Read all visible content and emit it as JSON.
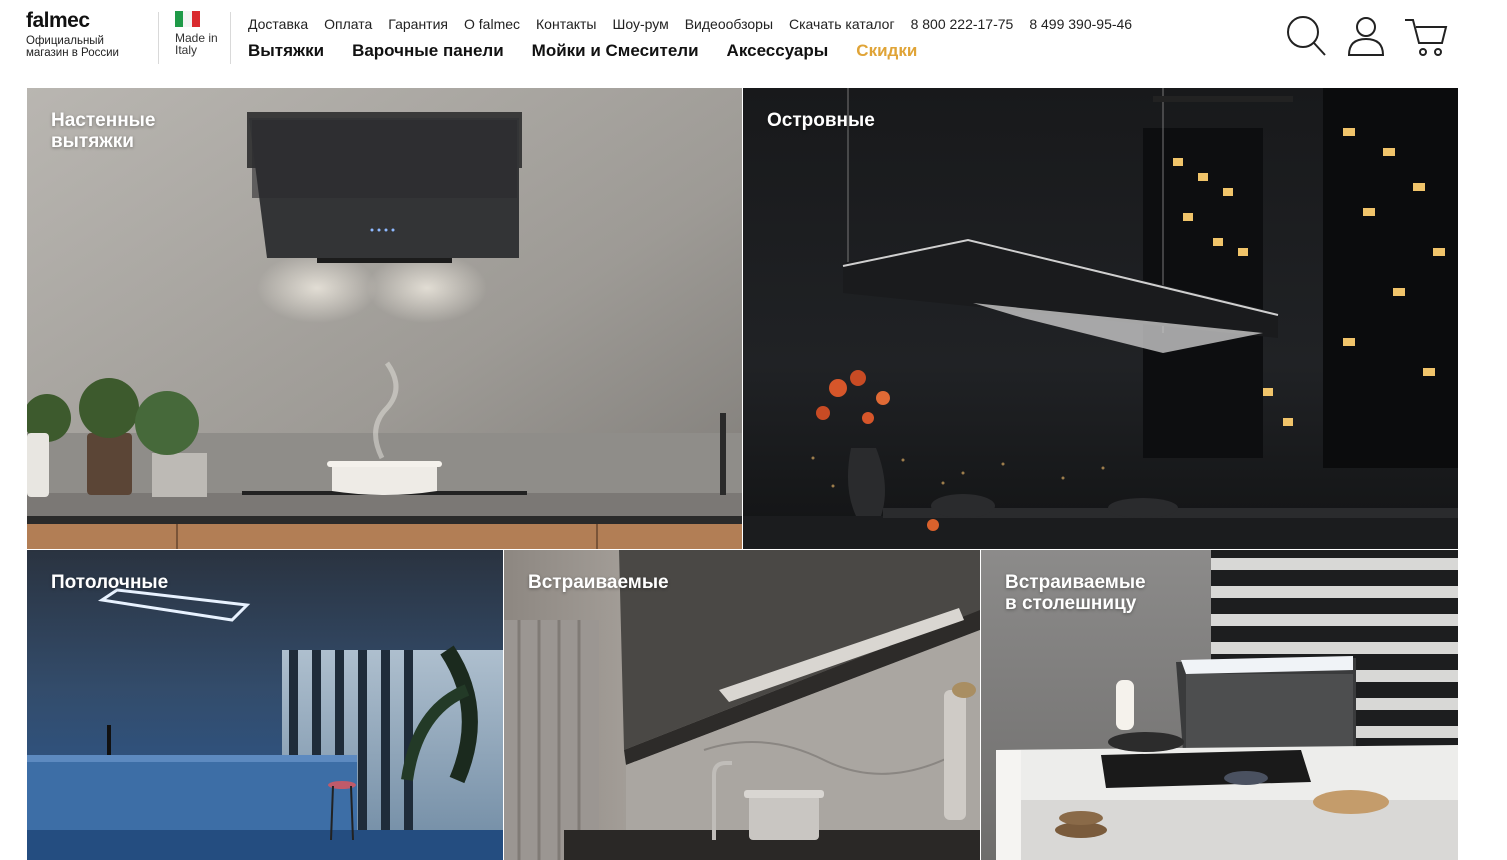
{
  "brand": {
    "logo": "falmec",
    "subtitle": "Официальный магазин в России",
    "made_in": "Made in Italy"
  },
  "nav_top": [
    "Доставка",
    "Оплата",
    "Гарантия",
    "О falmec",
    "Контакты",
    "Шоу-рум",
    "Видеообзоры",
    "Скачать каталог",
    "8 800 222-17-75",
    "8 499 390-95-46"
  ],
  "nav_main": [
    "Вытяжки",
    "Варочные панели",
    "Мойки и Смесители",
    "Аксессуары",
    "Скидки"
  ],
  "header_icons": [
    "search-icon",
    "user-icon",
    "cart-icon"
  ],
  "colors": {
    "sale": "#e0a437",
    "flag_green": "#1f9a48",
    "flag_red": "#d92a2e"
  },
  "tiles": [
    {
      "line1": "Настенные",
      "line2": "вытяжки"
    },
    {
      "line1": "Островные",
      "line2": ""
    },
    {
      "line1": "Потолочные",
      "line2": ""
    },
    {
      "line1": "Встраиваемые",
      "line2": ""
    },
    {
      "line1": "Встраиваемые",
      "line2": "в столешницу"
    }
  ]
}
